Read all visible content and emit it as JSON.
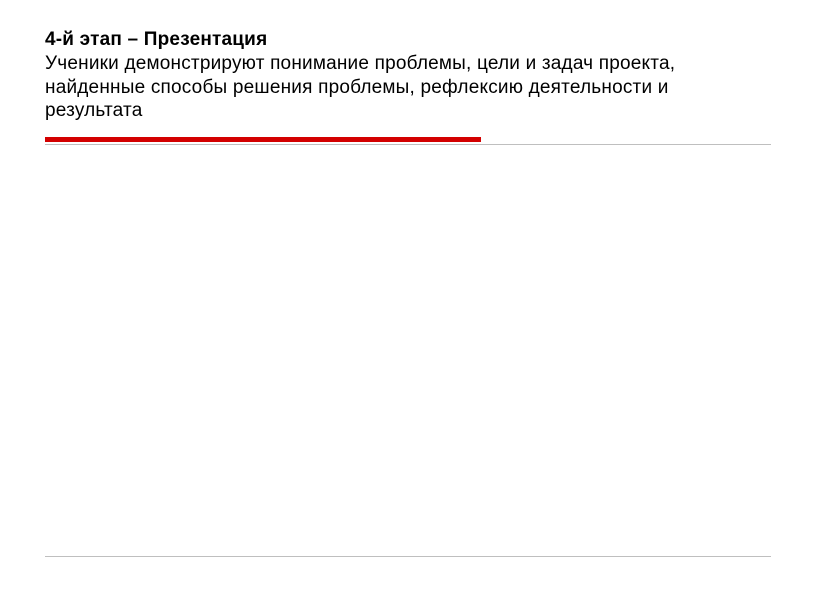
{
  "slide": {
    "title_bold": "4-й этап – Презентация",
    "body": "Ученики демонстрируют понимание проблемы, цели и задач проекта, найденные способы решения проблемы, рефлексию деятельности и результата"
  }
}
